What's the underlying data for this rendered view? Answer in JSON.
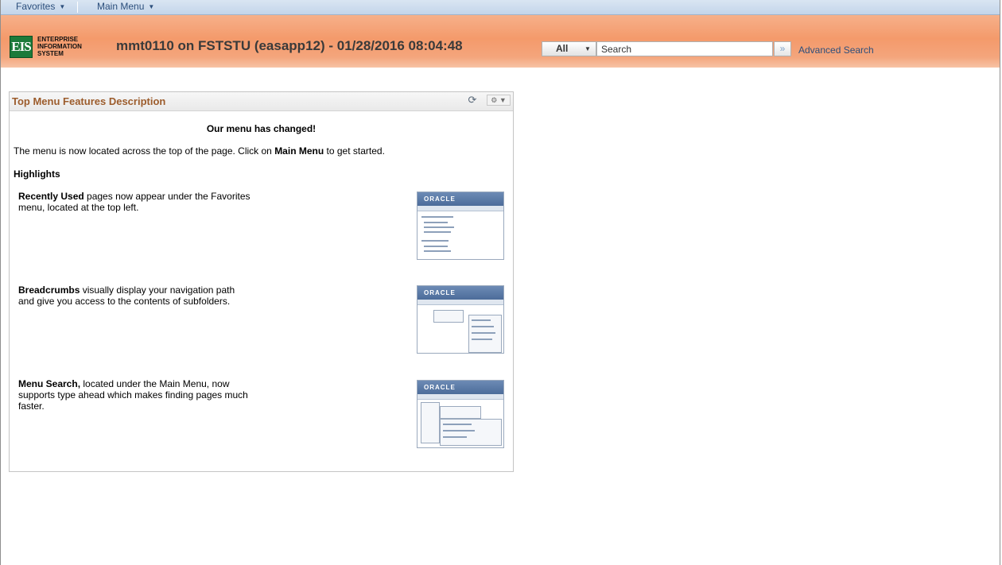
{
  "menubar": {
    "favorites_label": "Favorites",
    "main_menu_label": "Main Menu"
  },
  "header": {
    "logo_mark": "EIS",
    "logo_lines": [
      "ENTERPRISE",
      "INFORMATION",
      "SYSTEM"
    ],
    "session_title": "mmt0110 on FSTSTU (easapp12) - 01/28/2016 08:04:48",
    "search_scope": "All",
    "search_placeholder": "Search",
    "search_go_glyph": "»",
    "advanced_search_label": "Advanced Search"
  },
  "pagelet": {
    "title": "Top Menu Features Description",
    "refresh_glyph": "⟳",
    "gear_glyph": "⚙ ▼",
    "heading": "Our menu has changed!",
    "intro_pre": "The menu is now located across the top of the page. Click on ",
    "intro_bold": "Main Menu",
    "intro_post": " to get started.",
    "highlights_label": "Highlights",
    "features": [
      {
        "bold": "Recently Used",
        "text": " pages now appear under the Favorites menu, located at the top left.",
        "thumb_logo": "ORACLE"
      },
      {
        "bold": "Breadcrumbs",
        "text": " visually display your navigation path and give you access to the contents of subfolders.",
        "thumb_logo": "ORACLE"
      },
      {
        "bold": "Menu Search,",
        "text": " located under the Main Menu, now supports type ahead which makes finding pages much faster.",
        "thumb_logo": "ORACLE"
      }
    ]
  },
  "colors": {
    "header_orange": "#f49a6b",
    "menubar_blue": "#c3d5ea",
    "pagelet_title": "#9c5c2c",
    "link_blue": "#2c4f7c"
  }
}
